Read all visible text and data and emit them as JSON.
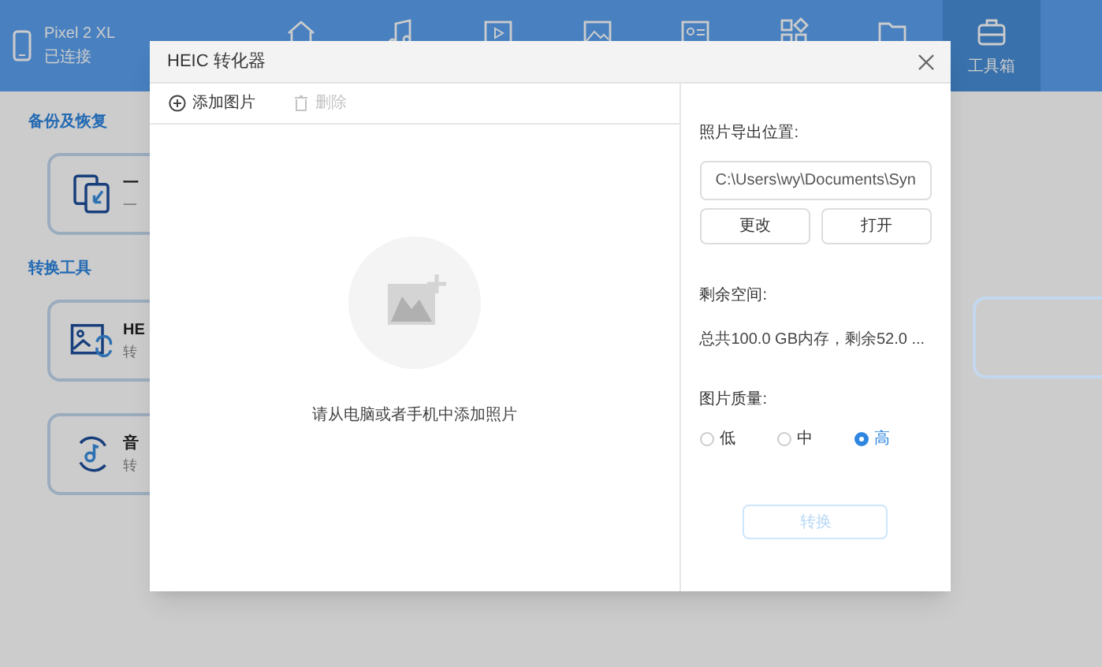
{
  "device": {
    "name": "Pixel 2 XL",
    "status": "已连接"
  },
  "nav": [
    {
      "kind": "home",
      "selected": false
    },
    {
      "kind": "music",
      "selected": false
    },
    {
      "kind": "video",
      "selected": false
    },
    {
      "kind": "image",
      "selected": false
    },
    {
      "kind": "contact",
      "selected": false
    },
    {
      "kind": "apps",
      "selected": false
    },
    {
      "kind": "folder",
      "selected": false
    },
    {
      "kind": "toolbox",
      "label": "工具箱",
      "selected": true
    }
  ],
  "sections": [
    {
      "title": "备份及恢复",
      "cards": [
        {
          "kind": "backup",
          "title": "一",
          "subtitle": "一"
        }
      ]
    },
    {
      "title": "转换工具",
      "cards": [
        {
          "kind": "heic",
          "title": "HE",
          "subtitle": "转"
        },
        {
          "kind": "audio",
          "title": "音",
          "subtitle": "转"
        }
      ]
    }
  ],
  "dialog": {
    "title": "HEIC 转化器",
    "toolbar": [
      {
        "kind": "add",
        "label": "添加图片",
        "disabled": false
      },
      {
        "kind": "delete",
        "label": "删除",
        "disabled": true
      }
    ],
    "empty_hint": "请从电脑或者手机中添加照片",
    "output_label": "照片导出位置:",
    "output_path": "C:\\Users\\wy\\Documents\\Syn",
    "path_buttons": [
      "更改",
      "打开"
    ],
    "space_label": "剩余空间:",
    "space_text": "总共100.0 GB内存，剩余52.0 ...",
    "quality_label": "图片质量:",
    "quality": [
      {
        "label": "低",
        "selected": false
      },
      {
        "label": "中",
        "selected": false
      },
      {
        "label": "高",
        "selected": true
      }
    ],
    "convert": {
      "label": "转换",
      "disabled": true
    }
  }
}
